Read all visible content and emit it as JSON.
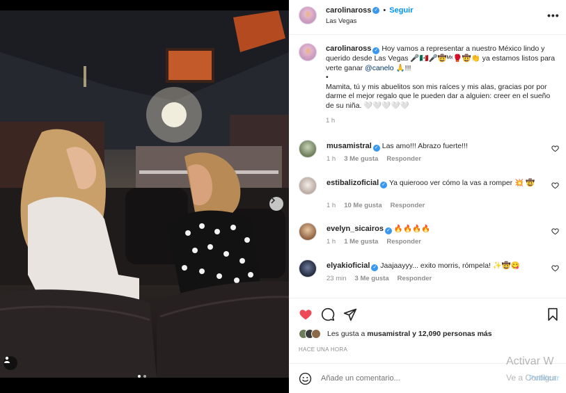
{
  "post": {
    "author": "carolinaross",
    "follow_label": "Seguir",
    "location": "Las Vegas",
    "more_label": "•••",
    "carousel_total": 2,
    "carousel_current": 1
  },
  "caption": {
    "author": "carolinaross",
    "line1_a": "Hoy vamos a representar a nuestro México lindo y querido desde Las Vegas 🎤🇲🇽🎤🤠ᴹˣ🥊🤠👏 ya estamos listos para verte ganar ",
    "mention": "@canelo",
    "line1_b": " 🙏!!!",
    "dot": "•",
    "line2": "Mamita, tú y mis abuelitos son mis raíces y mis alas, gracias por por darme el mejor regalo que le pueden dar a alguien: creer en el sueño de su niña. 🤍🤍🤍🤍🤍",
    "time": "1 h"
  },
  "comments": [
    {
      "user": "musamistral",
      "verified": true,
      "text": "Las amo!!! Abrazo fuerte!!!",
      "time": "1 h",
      "likes": "3 Me gusta",
      "reply": "Responder"
    },
    {
      "user": "estibalizoficial",
      "verified": true,
      "text": "Ya quierooo ver cómo la vas a romper 💥 🤠",
      "time": "1 h",
      "likes": "10 Me gusta",
      "reply": "Responder"
    },
    {
      "user": "evelyn_sicairos",
      "verified": true,
      "text": "🔥🔥🔥🔥",
      "time": "1 h",
      "likes": "1 Me gusta",
      "reply": "Responder"
    },
    {
      "user": "elyakioficial",
      "verified": true,
      "text": "Jaajaayyy... exito morris, rómpela! ✨🤠😋",
      "time": "23 min",
      "likes": "3 Me gusta",
      "reply": "Responder"
    }
  ],
  "likes": {
    "text_prefix": "Les gusta a ",
    "liker": "musamistral",
    "text_suffix": " y 12,090 personas más"
  },
  "posted_time": "HACE UNA HORA",
  "add_comment": {
    "placeholder": "Añade un comentario...",
    "publish": "Publicar"
  },
  "watermark": {
    "line1": "Activar W",
    "line2": "Ve a Configur"
  },
  "colors": {
    "accent": "#0095f6",
    "like_red": "#ed4956",
    "verified": "#3897f0"
  }
}
